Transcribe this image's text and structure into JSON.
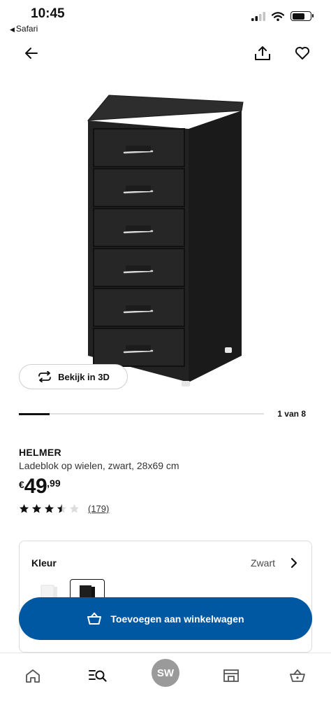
{
  "status_bar": {
    "time": "10:45",
    "back_app_label": "Safari",
    "icons": [
      "signal-icon",
      "wifi-icon",
      "battery-icon"
    ]
  },
  "top_nav": {
    "icons": [
      "back-arrow-icon",
      "share-icon",
      "heart-icon"
    ]
  },
  "gallery": {
    "view_3d_label": "Bekijk in 3D",
    "counter_text": "1 van 8",
    "current": 1,
    "total": 8
  },
  "product": {
    "name": "HELMER",
    "description": "Ladeblok op wielen, zwart, 28x69 cm",
    "price": {
      "currency": "€",
      "integer": "49",
      "decimal": ",99"
    },
    "rating": {
      "value": 3.5,
      "max": 5,
      "count_text": "(179)"
    }
  },
  "color_selector": {
    "label": "Kleur",
    "selected_value": "Zwart",
    "options": [
      "white",
      "black"
    ]
  },
  "actions": {
    "add_to_cart_label": "Toevoegen aan winkelwagen"
  },
  "tab_bar": {
    "avatar_initials": "SW",
    "tabs": [
      "home-icon",
      "search-icon",
      "profile-avatar",
      "store-icon",
      "basket-icon"
    ]
  },
  "colors": {
    "primary_blue": "#0058a3",
    "avatar_grey": "#9a9a9a",
    "product_black": "#1e1e1e"
  }
}
